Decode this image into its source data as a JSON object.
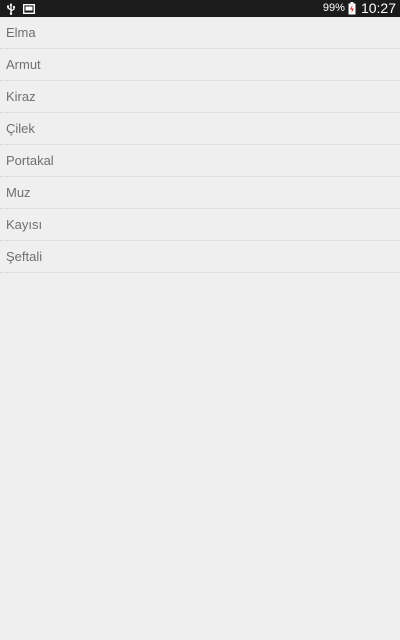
{
  "status_bar": {
    "icons_left": [
      "usb-icon",
      "screenshot-icon"
    ],
    "battery_percent": "99%",
    "battery_icon": "battery-charging-icon",
    "time": "10:27",
    "background_color": "#1b1b1b"
  },
  "list": {
    "items": [
      {
        "label": "Elma"
      },
      {
        "label": "Armut"
      },
      {
        "label": "Kiraz"
      },
      {
        "label": "Çilek"
      },
      {
        "label": "Portakal"
      },
      {
        "label": "Muz"
      },
      {
        "label": "Kayısı"
      },
      {
        "label": "Şeftali"
      }
    ]
  }
}
